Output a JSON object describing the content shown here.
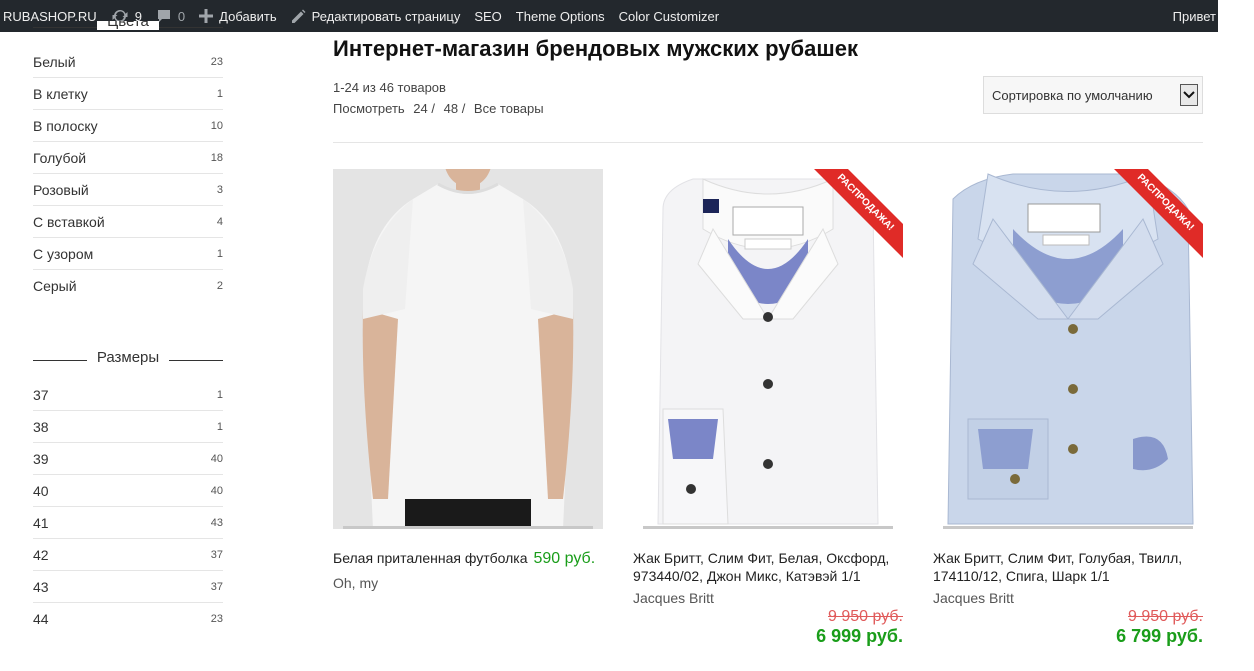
{
  "adminbar": {
    "site": "RUBASHOP.RU",
    "updates": "9",
    "comments": "0",
    "add": "Добавить",
    "edit": "Редактировать страницу",
    "seo": "SEO",
    "theme_options": "Theme Options",
    "color_customizer": "Color Customizer",
    "greeting": "Привет"
  },
  "sidebar": {
    "colors_title": "Цвета",
    "colors": [
      {
        "label": "Белый",
        "count": "23"
      },
      {
        "label": "В клетку",
        "count": "1"
      },
      {
        "label": "В полоску",
        "count": "10"
      },
      {
        "label": "Голубой",
        "count": "18"
      },
      {
        "label": "Розовый",
        "count": "3"
      },
      {
        "label": "С вставкой",
        "count": "4"
      },
      {
        "label": "С узором",
        "count": "1"
      },
      {
        "label": "Серый",
        "count": "2"
      }
    ],
    "sizes_title": "Размеры",
    "sizes": [
      {
        "label": "37",
        "count": "1"
      },
      {
        "label": "38",
        "count": "1"
      },
      {
        "label": "39",
        "count": "40"
      },
      {
        "label": "40",
        "count": "40"
      },
      {
        "label": "41",
        "count": "43"
      },
      {
        "label": "42",
        "count": "37"
      },
      {
        "label": "43",
        "count": "37"
      },
      {
        "label": "44",
        "count": "23"
      }
    ]
  },
  "main": {
    "title": "Интернет-магазин брендовых мужских рубашек",
    "result_count": "1-24 из 46 товаров",
    "per_page_label": "Посмотреть",
    "per_page_24": "24",
    "per_page_48": "48",
    "per_page_all": "Все товары",
    "sorting": "Сортировка по умолчанию"
  },
  "products": [
    {
      "title": "Белая приталенная футболка",
      "price": "590 руб.",
      "brand": "Oh, my"
    },
    {
      "title": "Жак Бритт, Слим Фит, Белая, Оксфорд, 973440/02, Джон Микс, Катэвэй 1/1",
      "brand": "Jacques Britt",
      "old_price": "9 950 руб.",
      "new_price": "6 999 руб.",
      "badge": "РАСПРОДАЖА!"
    },
    {
      "title": "Жак Бритт, Слим Фит, Голубая, Твилл, 174110/12, Спига, Шарк 1/1",
      "brand": "Jacques Britt",
      "old_price": "9 950 руб.",
      "new_price": "6 799 руб.",
      "badge": "РАСПРОДАЖА!"
    }
  ],
  "colors": {
    "admin_bg": "#23282d",
    "price_green": "#1a9d1a",
    "old_price_red": "#e05a5a",
    "sale_red": "#e02b27"
  }
}
